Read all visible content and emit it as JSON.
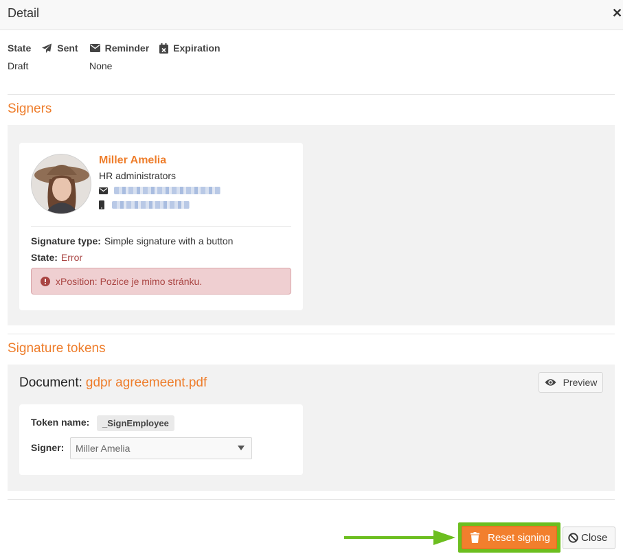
{
  "header": {
    "title": "Detail",
    "close_glyph": "✕"
  },
  "meta": {
    "state_label": "State",
    "sent_label": "Sent",
    "reminder_label": "Reminder",
    "expiration_label": "Expiration",
    "state_value": "Draft",
    "reminder_value": "None",
    "icons": {
      "sent": "paper-plane-icon",
      "reminder": "envelope-icon",
      "expiration": "calendar-x-icon"
    }
  },
  "signers": {
    "title": "Signers",
    "signer": {
      "name": "Miller Amelia",
      "role": "HR administrators",
      "email_icon": "envelope-icon",
      "phone_icon": "mobile-phone-icon",
      "signature_type_label": "Signature type:",
      "signature_type_value": "Simple signature with a button",
      "state_label": "State:",
      "state_value": "Error",
      "error_message": "xPosition: Pozice je mimo stránku."
    }
  },
  "tokens": {
    "title": "Signature tokens",
    "document_label": "Document:",
    "document_name": "gdpr agreemeent.pdf",
    "preview_label": "Preview",
    "token_name_label": "Token name:",
    "token_name_value": "_SignEmployee",
    "signer_label": "Signer:",
    "signer_selected": "Miller Amelia"
  },
  "footer": {
    "reset_label": "Reset signing",
    "close_label": "Close"
  },
  "colors": {
    "accent": "#ee7d2b",
    "error_text": "#a94442",
    "error_bg": "#efcfd1",
    "highlight_green": "#6cbe1f",
    "reset_button": "#f27f2d"
  }
}
